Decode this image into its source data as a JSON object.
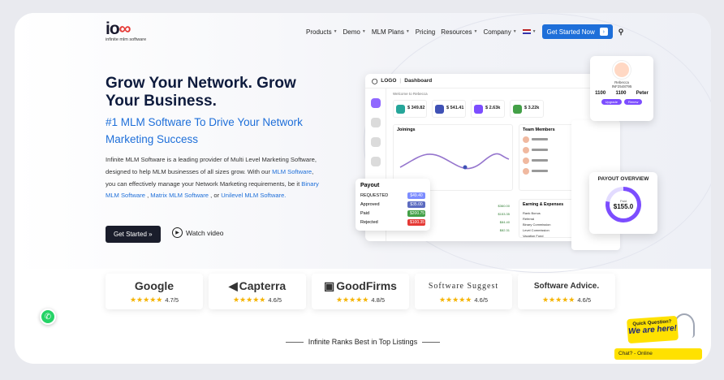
{
  "nav": {
    "logo_text": "ioss",
    "logo_tagline": "infinite mlm software",
    "items": [
      {
        "label": "Products",
        "dropdown": true
      },
      {
        "label": "Demo",
        "dropdown": true
      },
      {
        "label": "MLM Plans",
        "dropdown": true
      },
      {
        "label": "Pricing",
        "dropdown": false
      },
      {
        "label": "Resources",
        "dropdown": true
      },
      {
        "label": "Company",
        "dropdown": true
      }
    ],
    "cta_label": "Get Started Now",
    "cta_arrow": "›",
    "search_icon": "search-icon"
  },
  "hero": {
    "title": "Grow Your Network. Grow Your Business.",
    "subtitle": "#1 MLM Software To Drive Your Network Marketing Success",
    "description_parts": [
      {
        "text": "Infinite MLM Software is a leading provider of Multi Level Marketing Software, designed to help MLM businesses of all sizes grow. With our ",
        "link": false
      },
      {
        "text": "MLM Software",
        "link": true
      },
      {
        "text": ", you can effectively manage your Network Marketing requirements, be it ",
        "link": false
      },
      {
        "text": "Binary MLM Software",
        "link": true
      },
      {
        "text": " , ",
        "link": false
      },
      {
        "text": "Matrix MLM Software",
        "link": true
      },
      {
        "text": " , or ",
        "link": false
      },
      {
        "text": "Unilevel MLM Software.",
        "link": true
      }
    ],
    "get_started_label": "Get Started »",
    "watch_label": "Watch video"
  },
  "dashboard": {
    "logo": "LOGO",
    "title": "Dashboard",
    "welcome": "Welcome to Rebecca",
    "stats": [
      "$ 349.82",
      "$ 541.41",
      "$ 2.63k",
      "$ 3.22k"
    ],
    "joinings_title": "Joinings",
    "team_title": "Team Members",
    "earnings_title": "Earning & Expenses",
    "earnings": [
      {
        "label": "Rank Bonus",
        "value": "$0.78"
      },
      {
        "label": "Referral",
        "value": "$90.28"
      },
      {
        "label": "Binary Commission",
        "value": "$317.00"
      },
      {
        "label": "Level Commission",
        "value": "$60.13"
      },
      {
        "label": "Vacation Fund",
        "value": "$3.20"
      }
    ],
    "table_values": [
      "$360.00",
      "$153.35",
      "$84.40",
      "$82.31"
    ]
  },
  "payout_card": {
    "title": "Payout",
    "rows": [
      {
        "label": "REQUESTED",
        "value": "$49.40",
        "color": "#7c8cff"
      },
      {
        "label": "Approved",
        "value": "$35.00",
        "color": "#5c6bc0"
      },
      {
        "label": "Paid",
        "value": "$200.75",
        "color": "#43a047"
      },
      {
        "label": "Rejected",
        "value": "$100.35",
        "color": "#e53935"
      }
    ]
  },
  "profile_card": {
    "name": "Rebecca",
    "id": "INF2548795",
    "stats": [
      "1100",
      "1100",
      "Peter"
    ],
    "buttons": [
      "Upgrade",
      "Renew"
    ]
  },
  "payout_overview": {
    "title": "PAYOUT OVERVIEW",
    "label": "Paid",
    "value": "$155.0",
    "fraction": 0.78
  },
  "reviews": [
    {
      "brand": "Google",
      "score": "4.7/5"
    },
    {
      "brand": "Capterra",
      "score": "4.6/5"
    },
    {
      "brand": "GoodFirms",
      "score": "4.8/5"
    },
    {
      "brand": "Software Suggest",
      "score": "4.6/5"
    },
    {
      "brand": "Software Advice.",
      "score": "4.6/5"
    }
  ],
  "ranks_text": "Infinite Ranks Best in Top Listings",
  "chat": {
    "bubble_line1": "Quick Question?",
    "bubble_line2": "We are here!",
    "status": "Chat? - Online"
  },
  "colors": {
    "accent": "#1e6fd9",
    "dark": "#0e1b3d",
    "purple": "#7c4dff",
    "star": "#f5b301",
    "whatsapp": "#25d366"
  }
}
